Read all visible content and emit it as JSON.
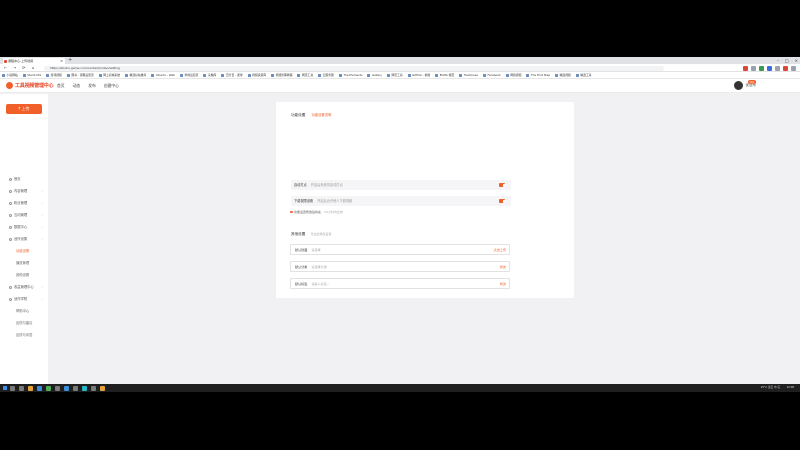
{
  "browser": {
    "tab_title": "课程中心-上传视频",
    "url": "https://studio.game.com/content/video/setting",
    "bookmarks": [
      "小说网站",
      "Stand-IOS",
      "游戏视频",
      "图书 - 课程设置页",
      "网上商城系统",
      "精选好站推荐",
      "Ubuntu - Web",
      "学前班目录",
      "头像库",
      "百分百 - 课堂",
      "视频资源库",
      "视频管理教程",
      "网页工具",
      "云服务器",
      "The Elements",
      "Gallery",
      "网页工具",
      "GitHub - 前端",
      "ECMA 规范",
      "Treehouse",
      "Facebook",
      "网络视频",
      "The First Step",
      "精选视频",
      "精选工具"
    ]
  },
  "header": {
    "logo_text": "工具视频管理中心",
    "nav": [
      "首页",
      "动态",
      "发布",
      "创建中心"
    ],
    "username": "优选号",
    "badge": "消息"
  },
  "sidebar": {
    "upload_label": "上传",
    "items": [
      {
        "label": "首页",
        "type": "top"
      },
      {
        "label": "内容管理",
        "type": "top"
      },
      {
        "label": "粉丝管理",
        "type": "top"
      },
      {
        "label": "互动管理",
        "type": "top"
      },
      {
        "label": "数据中心",
        "type": "top"
      },
      {
        "label": "创作设置",
        "type": "top"
      },
      {
        "label": "功能设置",
        "type": "sub",
        "active": true
      },
      {
        "label": "播放管理",
        "type": "sub"
      },
      {
        "label": "其他设置",
        "type": "sub"
      },
      {
        "label": "收益管理中心",
        "type": "top"
      },
      {
        "label": "创作学院",
        "type": "top"
      },
      {
        "label": "帮助中心",
        "type": "sub"
      },
      {
        "label": "反馈与建议",
        "type": "sub"
      },
      {
        "label": "反馈与问答",
        "type": "sub"
      }
    ]
  },
  "main": {
    "section1": {
      "title": "功能设置",
      "link": "功能设置说明",
      "switches": [
        {
          "label": "自动打点",
          "desc": "开启后系统将自动打点",
          "on": true
        },
        {
          "label": "下载权限设置",
          "desc": "开启后允许他人下载视频",
          "on": true
        }
      ],
      "notice": "功能设置修改后将在",
      "notice_dim": "24小时内生效"
    },
    "section2": {
      "title": "其他设置",
      "hint": "可在此修改设置",
      "fields": [
        {
          "label": "默认封面",
          "placeholder": "请选择",
          "action": "点击上传"
        },
        {
          "label": "默认分类",
          "placeholder": "请选择分类",
          "action": "修改"
        },
        {
          "label": "默认标签",
          "placeholder": "请输入标签...",
          "action": "修改"
        }
      ]
    }
  },
  "taskbar": {
    "tray_text": "25°C 多云 中 英",
    "clock": "10:08"
  },
  "colors": {
    "accent": "#f2602a"
  }
}
